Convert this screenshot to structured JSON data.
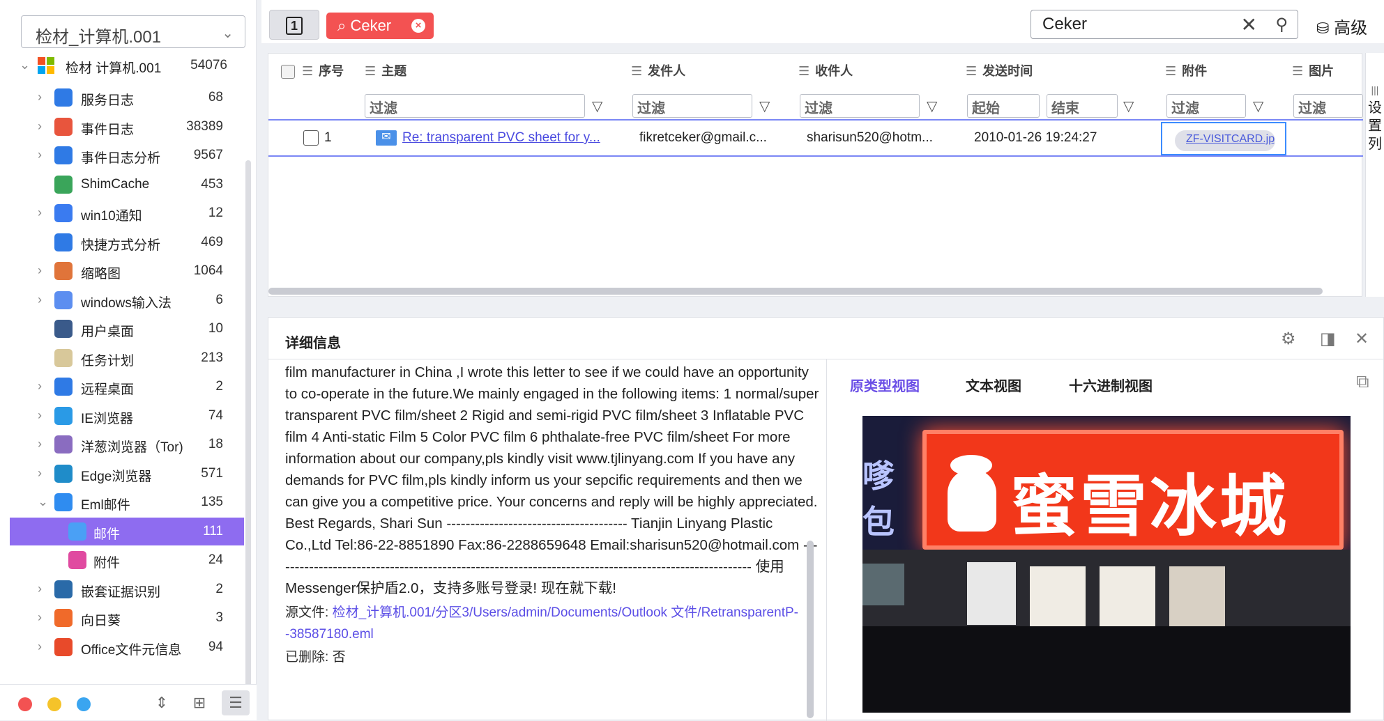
{
  "case_select": {
    "value": "检材_计算机.001"
  },
  "tree": {
    "root": {
      "label": "检材 计算机.001",
      "count": "54076"
    },
    "items": [
      {
        "label": "服务日志",
        "count": "68",
        "icon": "service-log-icon",
        "color": "#2f7ae5",
        "arrow": true
      },
      {
        "label": "事件日志",
        "count": "38389",
        "icon": "event-log-icon",
        "color": "#e8553d",
        "arrow": true
      },
      {
        "label": "事件日志分析",
        "count": "9567",
        "icon": "event-analysis-icon",
        "color": "#2f7ae5",
        "arrow": true
      },
      {
        "label": "ShimCache",
        "count": "453",
        "icon": "shimcache-icon",
        "color": "#3aa55a",
        "arrow": false
      },
      {
        "label": "win10通知",
        "count": "12",
        "icon": "bell-icon",
        "color": "#3a7bf0",
        "arrow": true
      },
      {
        "label": "快捷方式分析",
        "count": "469",
        "icon": "shortcut-icon",
        "color": "#2f7ae5",
        "arrow": false
      },
      {
        "label": "缩略图",
        "count": "1064",
        "icon": "thumbnail-icon",
        "color": "#e0743a",
        "arrow": true
      },
      {
        "label": "windows输入法",
        "count": "6",
        "icon": "keyboard-icon",
        "color": "#5c8ef0",
        "arrow": true
      },
      {
        "label": "用户桌面",
        "count": "10",
        "icon": "desktop-icon",
        "color": "#3a5a8a",
        "arrow": false
      },
      {
        "label": "任务计划",
        "count": "213",
        "icon": "clock-icon",
        "color": "#d8c89a",
        "arrow": false
      },
      {
        "label": "远程桌面",
        "count": "2",
        "icon": "remote-desktop-icon",
        "color": "#2f7ae5",
        "arrow": true
      },
      {
        "label": "IE浏览器",
        "count": "74",
        "icon": "ie-icon",
        "color": "#2a9ae6",
        "arrow": true
      },
      {
        "label": "洋葱浏览器（Tor)",
        "count": "18",
        "icon": "tor-icon",
        "color": "#8a6cc0",
        "arrow": true
      },
      {
        "label": "Edge浏览器",
        "count": "571",
        "icon": "edge-icon",
        "color": "#1f8cc9",
        "arrow": true
      },
      {
        "label": "Eml邮件",
        "count": "135",
        "icon": "mail-icon",
        "color": "#2f8cf0",
        "arrow": "open"
      },
      {
        "label": "邮件",
        "count": "111",
        "icon": "mail-sub-icon",
        "color": "#4aa0f5",
        "arrow": false,
        "active": true,
        "indent": true
      },
      {
        "label": "附件",
        "count": "24",
        "icon": "attachment-icon",
        "color": "#e04aa0",
        "arrow": false,
        "indent": true
      },
      {
        "label": "嵌套证据识别",
        "count": "2",
        "icon": "nested-evidence-icon",
        "color": "#2a6aa8",
        "arrow": true
      },
      {
        "label": "向日葵",
        "count": "3",
        "icon": "sunflower-icon",
        "color": "#f06a2a",
        "arrow": true
      },
      {
        "label": "Office文件元信息",
        "count": "94",
        "icon": "office-icon",
        "color": "#e84a2a",
        "arrow": true
      }
    ]
  },
  "sidebar_footer": {
    "dots": [
      "#f35252",
      "#f5c32a",
      "#3aa5f0"
    ],
    "icons": [
      "collapse-icon",
      "grid-view-icon",
      "list-view-icon"
    ]
  },
  "toolbar": {
    "tab_number": "1",
    "tag_label": "Ceker",
    "search_value": "Ceker",
    "advanced_label": "高级"
  },
  "table": {
    "columns": [
      "序号",
      "主题",
      "发件人",
      "收件人",
      "发送时间",
      "附件",
      "图片"
    ],
    "filters": {
      "generic": "过滤",
      "start": "起始",
      "end": "结束"
    },
    "rows": [
      {
        "index": "1",
        "subject": "Re: transparent PVC sheet for y...",
        "sender": "fikretceker@gmail.c...",
        "recipient": "sharisun520@hotm...",
        "sent_time": "2010-01-26 19:24:27",
        "attachment": "ZF-VISITCARD.jpg"
      }
    ],
    "column_settings_label": "设置列"
  },
  "details": {
    "title": "详细信息",
    "body": "film manufacturer in China ,I wrote this letter to see if we could have an opportunity to co-operate in the future.We mainly engaged in the following items: 1 normal/super transparent PVC film/sheet 2 Rigid and semi-rigid PVC film/sheet 3 Inflatable PVC film 4 Anti-static Film 5 Color PVC film 6 phthalate-free PVC film/sheet For more information about our company,pls kindly visit www.tjlinyang.com If you have any demands for PVC film,pls kindly inform us your sepcific requirements and then we can give you a competitive price. Your concerns and reply will be highly appreciated. Best Regards, Shari Sun -------------------------------------- Tianjin Linyang Plastic Co.,Ltd Tel:86-22-8851890 Fax:86-2288659648 Email:sharisun520@hotmail.com ----------------------------------------------------------------------------------------------------- 使用Messenger保护盾2.0，支持多账号登录! 现在就下载!",
    "source_label": "源文件:",
    "source_value": "检材_计算机.001/分区3/Users/admin/Documents/Outlook 文件/RetransparentP--38587180.eml",
    "deleted_label": "已删除:",
    "deleted_value": "否",
    "view_tabs": [
      {
        "label": "原类型视图",
        "active": true
      },
      {
        "label": "文本视图",
        "active": false
      },
      {
        "label": "十六进制视图",
        "active": false
      }
    ],
    "preview_sign_text": "蜜雪冰城"
  }
}
